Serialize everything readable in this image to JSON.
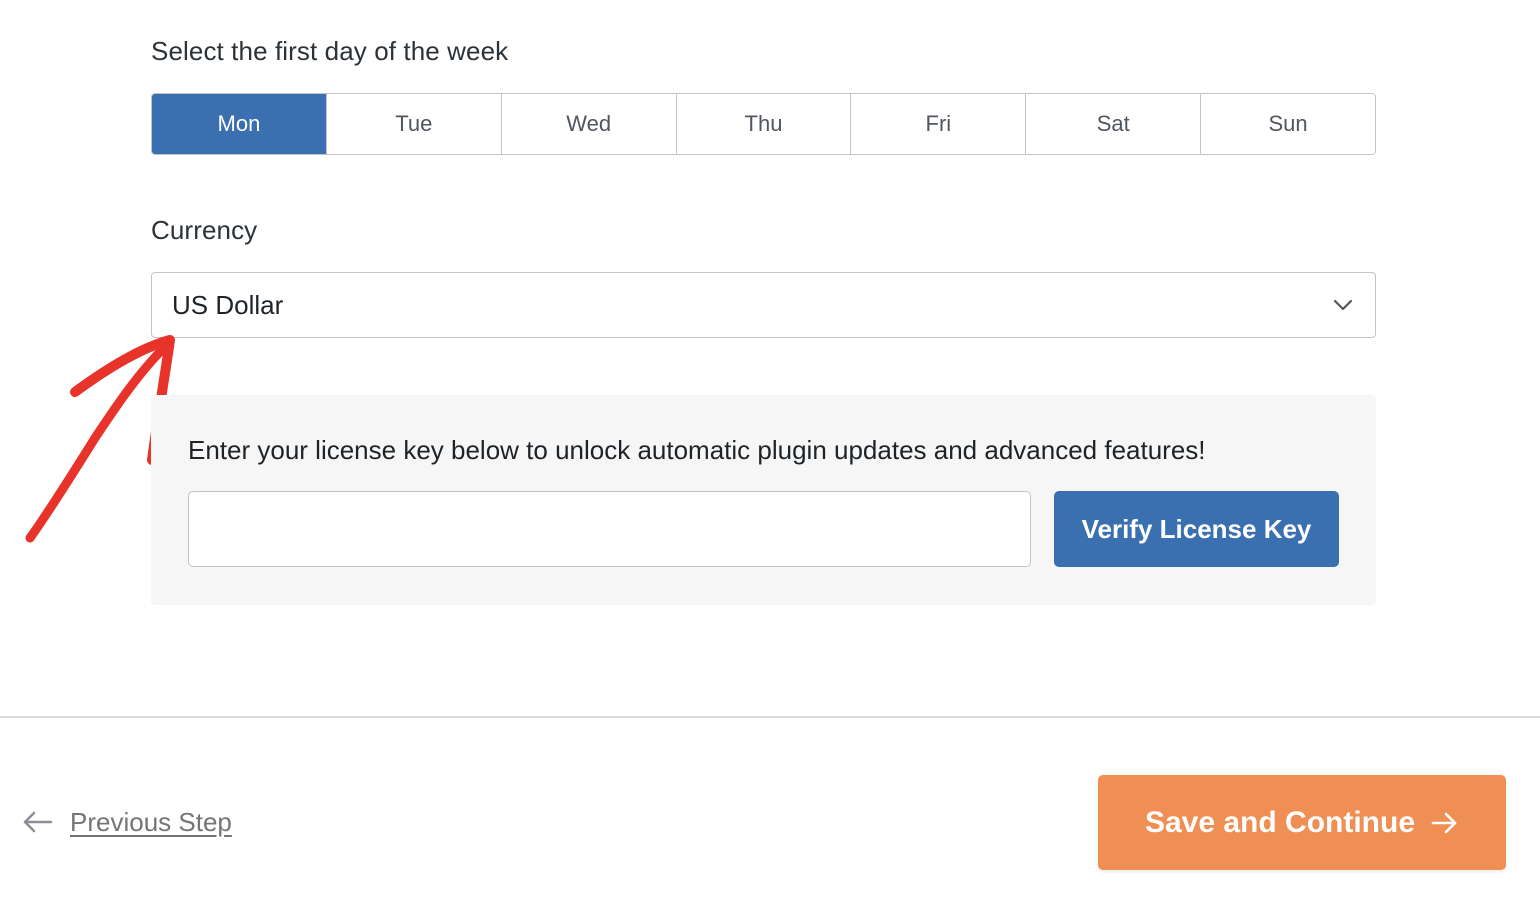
{
  "first_day": {
    "label": "Select the first day of the week",
    "days": [
      "Mon",
      "Tue",
      "Wed",
      "Thu",
      "Fri",
      "Sat",
      "Sun"
    ],
    "selected": "Mon"
  },
  "currency": {
    "label": "Currency",
    "selected": "US Dollar"
  },
  "license": {
    "message": "Enter your license key below to unlock automatic plugin updates and advanced features!",
    "input_value": "",
    "verify_label": "Verify License Key"
  },
  "footer": {
    "previous_label": "Previous Step",
    "save_label": "Save and Continue"
  },
  "colors": {
    "accent_blue": "#3a6fb0",
    "save_orange": "#ef8f53",
    "annotation_red": "#e8332a"
  },
  "icons": {
    "currency_dropdown": "chevron-down-icon",
    "previous": "arrow-left-icon",
    "save": "arrow-right-icon",
    "annotation": "annotation-arrow"
  }
}
